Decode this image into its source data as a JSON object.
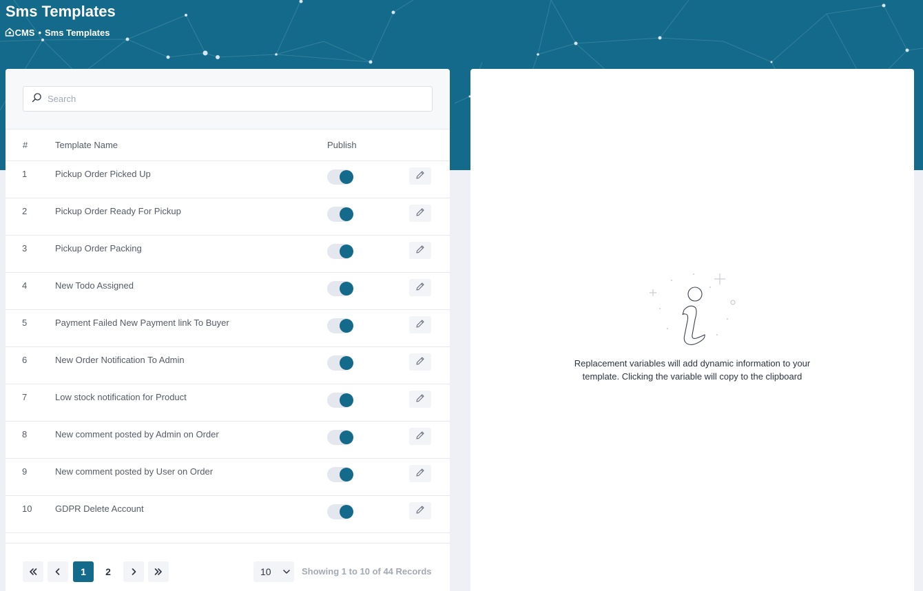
{
  "header": {
    "title": "Sms Templates",
    "breadcrumb": [
      "CMS",
      "Sms Templates"
    ],
    "breadcrumb_separator": "•",
    "home_icon": "home-icon"
  },
  "search": {
    "placeholder": "Search",
    "value": "",
    "icon": "search-icon"
  },
  "table": {
    "columns": {
      "num": "#",
      "name": "Template Name",
      "publish": "Publish"
    },
    "rows": [
      {
        "num": "1",
        "name": "Pickup Order Picked Up",
        "published": true
      },
      {
        "num": "2",
        "name": "Pickup Order Ready For Pickup",
        "published": true
      },
      {
        "num": "3",
        "name": "Pickup Order Packing",
        "published": true
      },
      {
        "num": "4",
        "name": "New Todo Assigned",
        "published": true
      },
      {
        "num": "5",
        "name": "Payment Failed New Payment link To Buyer",
        "published": true
      },
      {
        "num": "6",
        "name": "New Order Notification To Admin",
        "published": true
      },
      {
        "num": "7",
        "name": "Low stock notification for Product",
        "published": true
      },
      {
        "num": "8",
        "name": "New comment posted by Admin on Order",
        "published": true
      },
      {
        "num": "9",
        "name": "New comment posted by User on Order",
        "published": true
      },
      {
        "num": "10",
        "name": "GDPR Delete Account",
        "published": true
      }
    ],
    "row_action_icon": "pencil-icon"
  },
  "pagination": {
    "first": "«",
    "prev": "‹",
    "pages": [
      "1",
      "2"
    ],
    "current_page": "1",
    "next": "›",
    "last": "»",
    "per_page": "10",
    "records_text": "Showing 1 to 10 of 44 Records"
  },
  "info_panel": {
    "icon": "info-icon",
    "text": "Replacement variables will add dynamic information to your template. Clicking the variable will copy to the clipboard"
  },
  "colors": {
    "brand": "#146a8a",
    "background": "#eef0f6",
    "toggle_track": "#e4e7ee",
    "muted_text": "#a3a8b4"
  }
}
